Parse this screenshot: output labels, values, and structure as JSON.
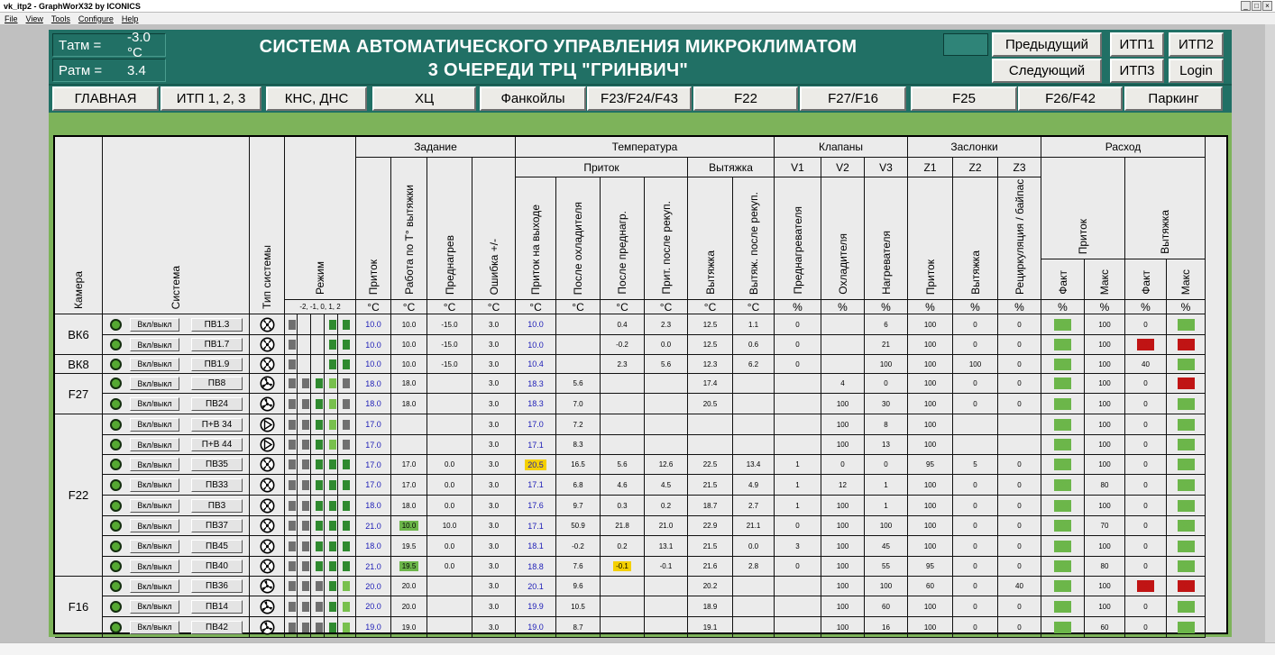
{
  "window": {
    "title": "vk_itp2 - GraphWorX32 by ICONICS",
    "menu": [
      "File",
      "View",
      "Tools",
      "Configure",
      "Help"
    ]
  },
  "header": {
    "tatm_label": "Tатм =",
    "tatm_value": "-3.0 °C",
    "patm_label": "Pатм =",
    "patm_value": "3.4",
    "title_line1": "СИСТЕМА АВТОМАТИЧЕСКОГО УПРАВЛЕНИЯ МИКРОКЛИМАТОМ",
    "title_line2": "3 ОЧЕРЕДИ ТРЦ \"ГРИНВИЧ\"",
    "prev": "Предыдущий",
    "next": "Следующий",
    "itp1": "ИТП1",
    "itp2": "ИТП2",
    "itp3": "ИТП3",
    "login": "Login"
  },
  "nav": [
    "ГЛАВНАЯ",
    "ИТП 1, 2, 3",
    "КНС, ДНС",
    "ХЦ",
    "Фанкойлы",
    "F23/F24/F43",
    "F22",
    "F27/F16",
    "F25",
    "F26/F42",
    "Паркинг"
  ],
  "table": {
    "h_camera": "Камера",
    "h_system": "Система",
    "h_type": "Тип системы",
    "h_mode": "Режим",
    "h_mode_sub": "-2, -1, 0, 1, 2",
    "h_zad": "Задание",
    "h_temp": "Температура",
    "h_klap": "Клапаны",
    "h_zasl": "Заслонки",
    "h_rash": "Расход",
    "h_pritok": "Приток",
    "h_vytyazhka": "Вытяжка",
    "h_v": [
      "V1",
      "V2",
      "V3"
    ],
    "h_z": [
      "Z1",
      "Z2",
      "Z3"
    ],
    "cols_zad": [
      "Приток",
      "Работа по Т° вытяжки",
      "Преднагрев",
      "Ошибка +/-"
    ],
    "cols_temp": [
      "Приток на выходе",
      "После охладителя",
      "После преднагр.",
      "Прит. после рекуп.",
      "Вытяжка",
      "Вытяж. после рекуп."
    ],
    "cols_klap": [
      "Преднагревателя",
      "Охладителя",
      "Нагревателя"
    ],
    "cols_zasl": [
      "Приток",
      "Вытяжка",
      "Рециркуляция / байпас рекуператора"
    ],
    "cols_rash": [
      "Факт",
      "Макс",
      "Факт",
      "Макс"
    ],
    "units": [
      "°C",
      "°C",
      "°C",
      "°C",
      "°C",
      "°C",
      "°C",
      "°C",
      "°C",
      "°C",
      "%",
      "%",
      "%",
      "%",
      "%",
      "%",
      "%",
      "%",
      "%",
      "%"
    ],
    "toggle_label": "Вкл/выкл",
    "cameras": [
      {
        "name": "ВК6",
        "rows": 2
      },
      {
        "name": "ВК8",
        "rows": 1
      },
      {
        "name": "F27",
        "rows": 2
      },
      {
        "name": "F22",
        "rows": 8
      },
      {
        "name": "F16",
        "rows": 3
      }
    ],
    "rows": [
      {
        "sys": "ПВ1.3",
        "icon": "x",
        "mode": [
          "grey",
          "",
          "",
          "green",
          "green"
        ],
        "v": [
          "10.0",
          "10.0",
          "-15.0",
          "3.0",
          "10.0",
          "",
          "0.4",
          "2.3",
          "12.5",
          "1.1",
          "0",
          "",
          "6",
          "100",
          "0",
          "0",
          "100",
          "100",
          "0",
          "100"
        ],
        "fx": {
          "16": "g",
          "19": "g"
        }
      },
      {
        "sys": "ПВ1.7",
        "icon": "x",
        "mode": [
          "grey",
          "",
          "",
          "green",
          "green"
        ],
        "v": [
          "10.0",
          "10.0",
          "-15.0",
          "3.0",
          "10.0",
          "",
          "-0.2",
          "0.0",
          "12.5",
          "0.6",
          "0",
          "",
          "21",
          "100",
          "0",
          "0",
          "100",
          "100",
          "0",
          "0"
        ],
        "fx": {
          "16": "g",
          "18": "r",
          "19": "r"
        }
      },
      {
        "sys": "ПВ1.9",
        "icon": "x",
        "mode": [
          "grey",
          "",
          "",
          "green",
          "green"
        ],
        "v": [
          "10.0",
          "10.0",
          "-15.0",
          "3.0",
          "10.4",
          "",
          "2.3",
          "5.6",
          "12.3",
          "6.2",
          "0",
          "",
          "100",
          "100",
          "100",
          "0",
          "100",
          "100",
          "40",
          "100"
        ],
        "fx": {
          "16": "g",
          "19": "g"
        }
      },
      {
        "sys": "ПВ8",
        "icon": "a",
        "mode": [
          "grey",
          "grey",
          "green",
          "lg",
          "grey"
        ],
        "v": [
          "18.0",
          "18.0",
          "",
          "3.0",
          "18.3",
          "5.6",
          "",
          "",
          "17.4",
          "",
          "",
          "4",
          "0",
          "100",
          "0",
          "0",
          "100",
          "100",
          "0",
          "0"
        ],
        "fx": {
          "16": "g",
          "19": "r"
        }
      },
      {
        "sys": "ПВ24",
        "icon": "a",
        "mode": [
          "grey",
          "grey",
          "green",
          "lg",
          "grey"
        ],
        "v": [
          "18.0",
          "18.0",
          "",
          "3.0",
          "18.3",
          "7.0",
          "",
          "",
          "20.5",
          "",
          "",
          "100",
          "30",
          "100",
          "0",
          "0",
          "100",
          "100",
          "0",
          "100"
        ],
        "fx": {
          "16": "g",
          "19": "g"
        }
      },
      {
        "sys": "П+В 34",
        "icon": "p",
        "mode": [
          "grey",
          "grey",
          "green",
          "lg",
          "grey"
        ],
        "v": [
          "17.0",
          "",
          "",
          "3.0",
          "17.0",
          "7.2",
          "",
          "",
          "",
          "",
          "",
          "100",
          "8",
          "100",
          "",
          "",
          "100",
          "100",
          "0",
          "30"
        ],
        "fx": {
          "16": "g",
          "19": "g"
        }
      },
      {
        "sys": "П+В 44",
        "icon": "p",
        "mode": [
          "grey",
          "grey",
          "green",
          "lg",
          "grey"
        ],
        "v": [
          "17.0",
          "",
          "",
          "3.0",
          "17.1",
          "8.3",
          "",
          "",
          "",
          "",
          "",
          "100",
          "13",
          "100",
          "",
          "",
          "100",
          "100",
          "0",
          "30"
        ],
        "fx": {
          "16": "g",
          "19": "g"
        }
      },
      {
        "sys": "ПВ35",
        "icon": "x",
        "mode": [
          "grey",
          "grey",
          "green",
          "green",
          "green"
        ],
        "v": [
          "17.0",
          "17.0",
          "0.0",
          "3.0",
          "20.5",
          "16.5",
          "5.6",
          "12.6",
          "22.5",
          "13.4",
          "1",
          "0",
          "0",
          "95",
          "5",
          "0",
          "100",
          "100",
          "0",
          "100"
        ],
        "fx": {
          "4": "y",
          "16": "g",
          "19": "g"
        }
      },
      {
        "sys": "ПВ33",
        "icon": "x",
        "mode": [
          "grey",
          "grey",
          "green",
          "green",
          "green"
        ],
        "v": [
          "17.0",
          "17.0",
          "0.0",
          "3.0",
          "17.1",
          "6.8",
          "4.6",
          "4.5",
          "21.5",
          "4.9",
          "1",
          "12",
          "1",
          "100",
          "0",
          "0",
          "80",
          "80",
          "0",
          "100"
        ],
        "fx": {
          "16": "g",
          "19": "g"
        }
      },
      {
        "sys": "ПВ3",
        "icon": "x",
        "mode": [
          "grey",
          "grey",
          "green",
          "green",
          "green"
        ],
        "v": [
          "18.0",
          "18.0",
          "0.0",
          "3.0",
          "17.6",
          "9.7",
          "0.3",
          "0.2",
          "18.7",
          "2.7",
          "1",
          "100",
          "1",
          "100",
          "0",
          "0",
          "100",
          "100",
          "0",
          "100"
        ],
        "fx": {
          "16": "g",
          "19": "g"
        }
      },
      {
        "sys": "ПВ37",
        "icon": "x",
        "mode": [
          "grey",
          "grey",
          "green",
          "green",
          "green"
        ],
        "v": [
          "21.0",
          "10.0",
          "10.0",
          "3.0",
          "17.1",
          "50.9",
          "21.8",
          "21.0",
          "22.9",
          "21.1",
          "0",
          "100",
          "100",
          "100",
          "0",
          "0",
          "31",
          "70",
          "0",
          "30"
        ],
        "fx": {
          "1": "g",
          "16": "g",
          "19": "g"
        }
      },
      {
        "sys": "ПВ45",
        "icon": "x",
        "mode": [
          "grey",
          "grey",
          "green",
          "green",
          "green"
        ],
        "v": [
          "18.0",
          "19.5",
          "0.0",
          "3.0",
          "18.1",
          "-0.2",
          "0.2",
          "13.1",
          "21.5",
          "0.0",
          "3",
          "100",
          "45",
          "100",
          "0",
          "0",
          "100",
          "100",
          "0",
          "100"
        ],
        "fx": {
          "16": "g",
          "19": "g"
        }
      },
      {
        "sys": "ПВ40",
        "icon": "x",
        "mode": [
          "grey",
          "grey",
          "green",
          "green",
          "green"
        ],
        "v": [
          "21.0",
          "19.5",
          "0.0",
          "3.0",
          "18.8",
          "7.6",
          "-0.1",
          "-0.1",
          "21.6",
          "2.8",
          "0",
          "100",
          "55",
          "95",
          "0",
          "0",
          "80",
          "80",
          "0",
          "35"
        ],
        "fx": {
          "1": "g",
          "6": "y",
          "16": "g",
          "19": "g"
        }
      },
      {
        "sys": "ПВ36",
        "icon": "a",
        "mode": [
          "grey",
          "grey",
          "grey",
          "green",
          "lg"
        ],
        "v": [
          "20.0",
          "20.0",
          "",
          "3.0",
          "20.1",
          "9.6",
          "",
          "",
          "20.2",
          "",
          "",
          "100",
          "100",
          "60",
          "0",
          "40",
          "100",
          "100",
          "0",
          "0"
        ],
        "fx": {
          "16": "g",
          "18": "r",
          "19": "r"
        }
      },
      {
        "sys": "ПВ14",
        "icon": "a",
        "mode": [
          "grey",
          "grey",
          "grey",
          "green",
          "lg"
        ],
        "v": [
          "20.0",
          "20.0",
          "",
          "3.0",
          "19.9",
          "10.5",
          "",
          "",
          "18.9",
          "",
          "",
          "100",
          "60",
          "100",
          "0",
          "0",
          "100",
          "100",
          "0",
          "100"
        ],
        "fx": {
          "16": "g",
          "19": "g"
        }
      },
      {
        "sys": "ПВ42",
        "icon": "a",
        "mode": [
          "grey",
          "grey",
          "grey",
          "green",
          "lg"
        ],
        "v": [
          "19.0",
          "19.0",
          "",
          "3.0",
          "19.0",
          "8.7",
          "",
          "",
          "19.1",
          "",
          "",
          "100",
          "16",
          "100",
          "0",
          "0",
          "60",
          "60",
          "0",
          "60"
        ],
        "fx": {
          "16": "g",
          "19": "g"
        }
      }
    ]
  }
}
